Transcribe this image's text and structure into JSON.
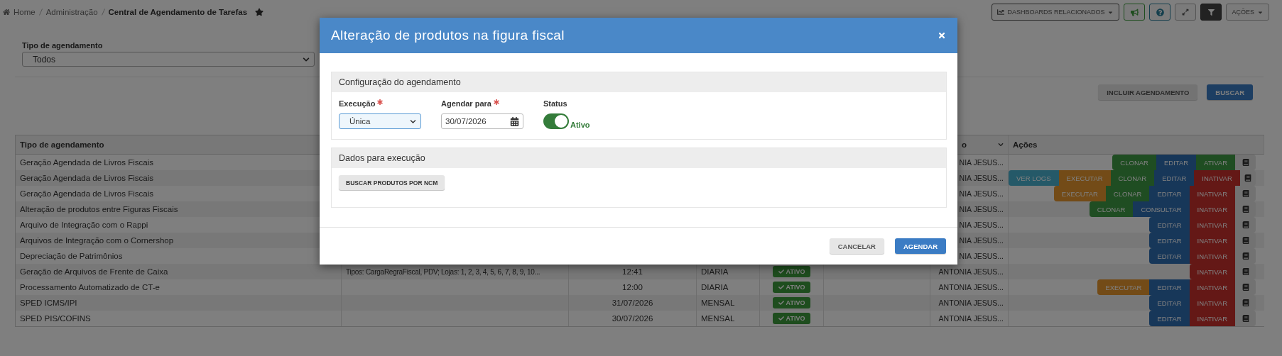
{
  "breadcrumb": [
    {
      "label": "Home",
      "current": false
    },
    {
      "label": "Administração",
      "current": false
    },
    {
      "label": "Central de Agendamento de Tarefas",
      "current": true
    }
  ],
  "toolbar": {
    "dashboards": "DASHBOARDS RELACIONADOS",
    "actions": "AÇÕES"
  },
  "filter": {
    "label": "Tipo de agendamento",
    "value": "Todos"
  },
  "buttons": [
    {
      "label": "INCLUIR AGENDAMENTO",
      "kind": "default"
    },
    {
      "label": "BUSCAR",
      "kind": "primary"
    }
  ],
  "table": {
    "columns": [
      {
        "label": "Tipo de agendamento"
      },
      {},
      {},
      {},
      {},
      {},
      {
        "label": "o",
        "sortable": true
      },
      {
        "label": "Ações"
      }
    ],
    "rows": [
      {
        "type": "Geração Agendada de Livros Fiscais",
        "user": "NIA JESUS...",
        "actions": [
          {
            "label": "CLONAR",
            "kind": "clone"
          },
          {
            "label": "EDITAR",
            "kind": "edit"
          },
          {
            "label": "ATIVAR",
            "kind": "activate"
          }
        ]
      },
      {
        "type": "Geração Agendada de Livros Fiscais",
        "user": "NIA JESUS...",
        "actions": [
          {
            "label": "VER LOGS",
            "kind": "logs"
          },
          {
            "label": "EXECUTAR",
            "kind": "run"
          },
          {
            "label": "CLONAR",
            "kind": "clone"
          },
          {
            "label": "EDITAR",
            "kind": "edit"
          },
          {
            "label": "INATIVAR",
            "kind": "deactivate"
          }
        ]
      },
      {
        "type": "Geração Agendada de Livros Fiscais",
        "user": "NIA JESUS...",
        "actions": [
          {
            "label": "EXECUTAR",
            "kind": "run"
          },
          {
            "label": "CLONAR",
            "kind": "clone"
          },
          {
            "label": "EDITAR",
            "kind": "edit"
          },
          {
            "label": "INATIVAR",
            "kind": "deactivate"
          }
        ]
      },
      {
        "type": "Alteração de produtos entre Figuras Fiscais",
        "user": "NIA JESUS...",
        "actions": [
          {
            "label": "CLONAR",
            "kind": "clone"
          },
          {
            "label": "CONSULTAR",
            "kind": "edit"
          },
          {
            "label": "INATIVAR",
            "kind": "deactivate"
          }
        ]
      },
      {
        "type": "Arquivo de Integração com o Rappi",
        "user": "NIA JESUS...",
        "actions": [
          {
            "label": "EDITAR",
            "kind": "edit"
          },
          {
            "label": "INATIVAR",
            "kind": "deactivate"
          }
        ]
      },
      {
        "type": "Arquivos de Integração com o Cornershop",
        "user": "NIA JESUS...",
        "actions": [
          {
            "label": "EDITAR",
            "kind": "edit"
          },
          {
            "label": "INATIVAR",
            "kind": "deactivate"
          }
        ]
      },
      {
        "type": "Depreciação de Patrimônios",
        "user": "NIA JESUS...",
        "actions": [
          {
            "label": "EDITAR",
            "kind": "edit"
          },
          {
            "label": "INATIVAR",
            "kind": "deactivate"
          }
        ]
      },
      {
        "type": "Geração de Arquivos de Frente de Caixa",
        "column_2": "Tipos: CargaRegraFiscal, PDV; Lojas: 1, 2, 3, 4, 5, 6, 7, 8, 9, 10...",
        "column_3": "12:41",
        "column_4": "DIARIA",
        "status": "ATIVO",
        "user": "ANTONIA JESUS...",
        "actions": [
          {
            "label": "INATIVAR",
            "kind": "deactivate"
          }
        ]
      },
      {
        "type": "Processamento Automatizado de CT-e",
        "column_3": "12:00",
        "column_4": "DIARIA",
        "status": "ATIVO",
        "user": "ANTONIA JESUS...",
        "actions": [
          {
            "label": "EXECUTAR",
            "kind": "run"
          },
          {
            "label": "EDITAR",
            "kind": "edit"
          },
          {
            "label": "INATIVAR",
            "kind": "deactivate"
          }
        ]
      },
      {
        "type": "SPED ICMS/IPI",
        "column_3": "31/07/2026",
        "column_4": "MENSAL",
        "status": "ATIVO",
        "user": "ANTONIA JESUS...",
        "actions": [
          {
            "label": "EDITAR",
            "kind": "edit"
          },
          {
            "label": "INATIVAR",
            "kind": "deactivate"
          }
        ]
      },
      {
        "type": "SPED PIS/COFINS",
        "column_3": "30/07/2026",
        "column_4": "MENSAL",
        "status": "ATIVO",
        "user": "ANTONIA JESUS...",
        "actions": [
          {
            "label": "EDITAR",
            "kind": "edit"
          },
          {
            "label": "INATIVAR",
            "kind": "deactivate"
          }
        ]
      }
    ]
  },
  "modal": {
    "title": "Alteração de produtos na figura fiscal",
    "config": {
      "title": "Configuração do agendamento",
      "fields": [
        {
          "kind": "select",
          "label": "Execução",
          "required": true,
          "value": "Única"
        },
        {
          "kind": "date",
          "label": "Agendar para",
          "required": true,
          "value": "30/07/2026"
        },
        {
          "kind": "toggle",
          "label": "Status",
          "on": true,
          "caption": "Ativo"
        }
      ]
    },
    "data_section": {
      "title": "Dados para execução",
      "button": "BUSCAR PRODUTOS POR NCM"
    },
    "footer_buttons": [
      {
        "label": "CANCELAR",
        "kind": "default"
      },
      {
        "label": "AGENDAR",
        "kind": "primary"
      }
    ]
  }
}
